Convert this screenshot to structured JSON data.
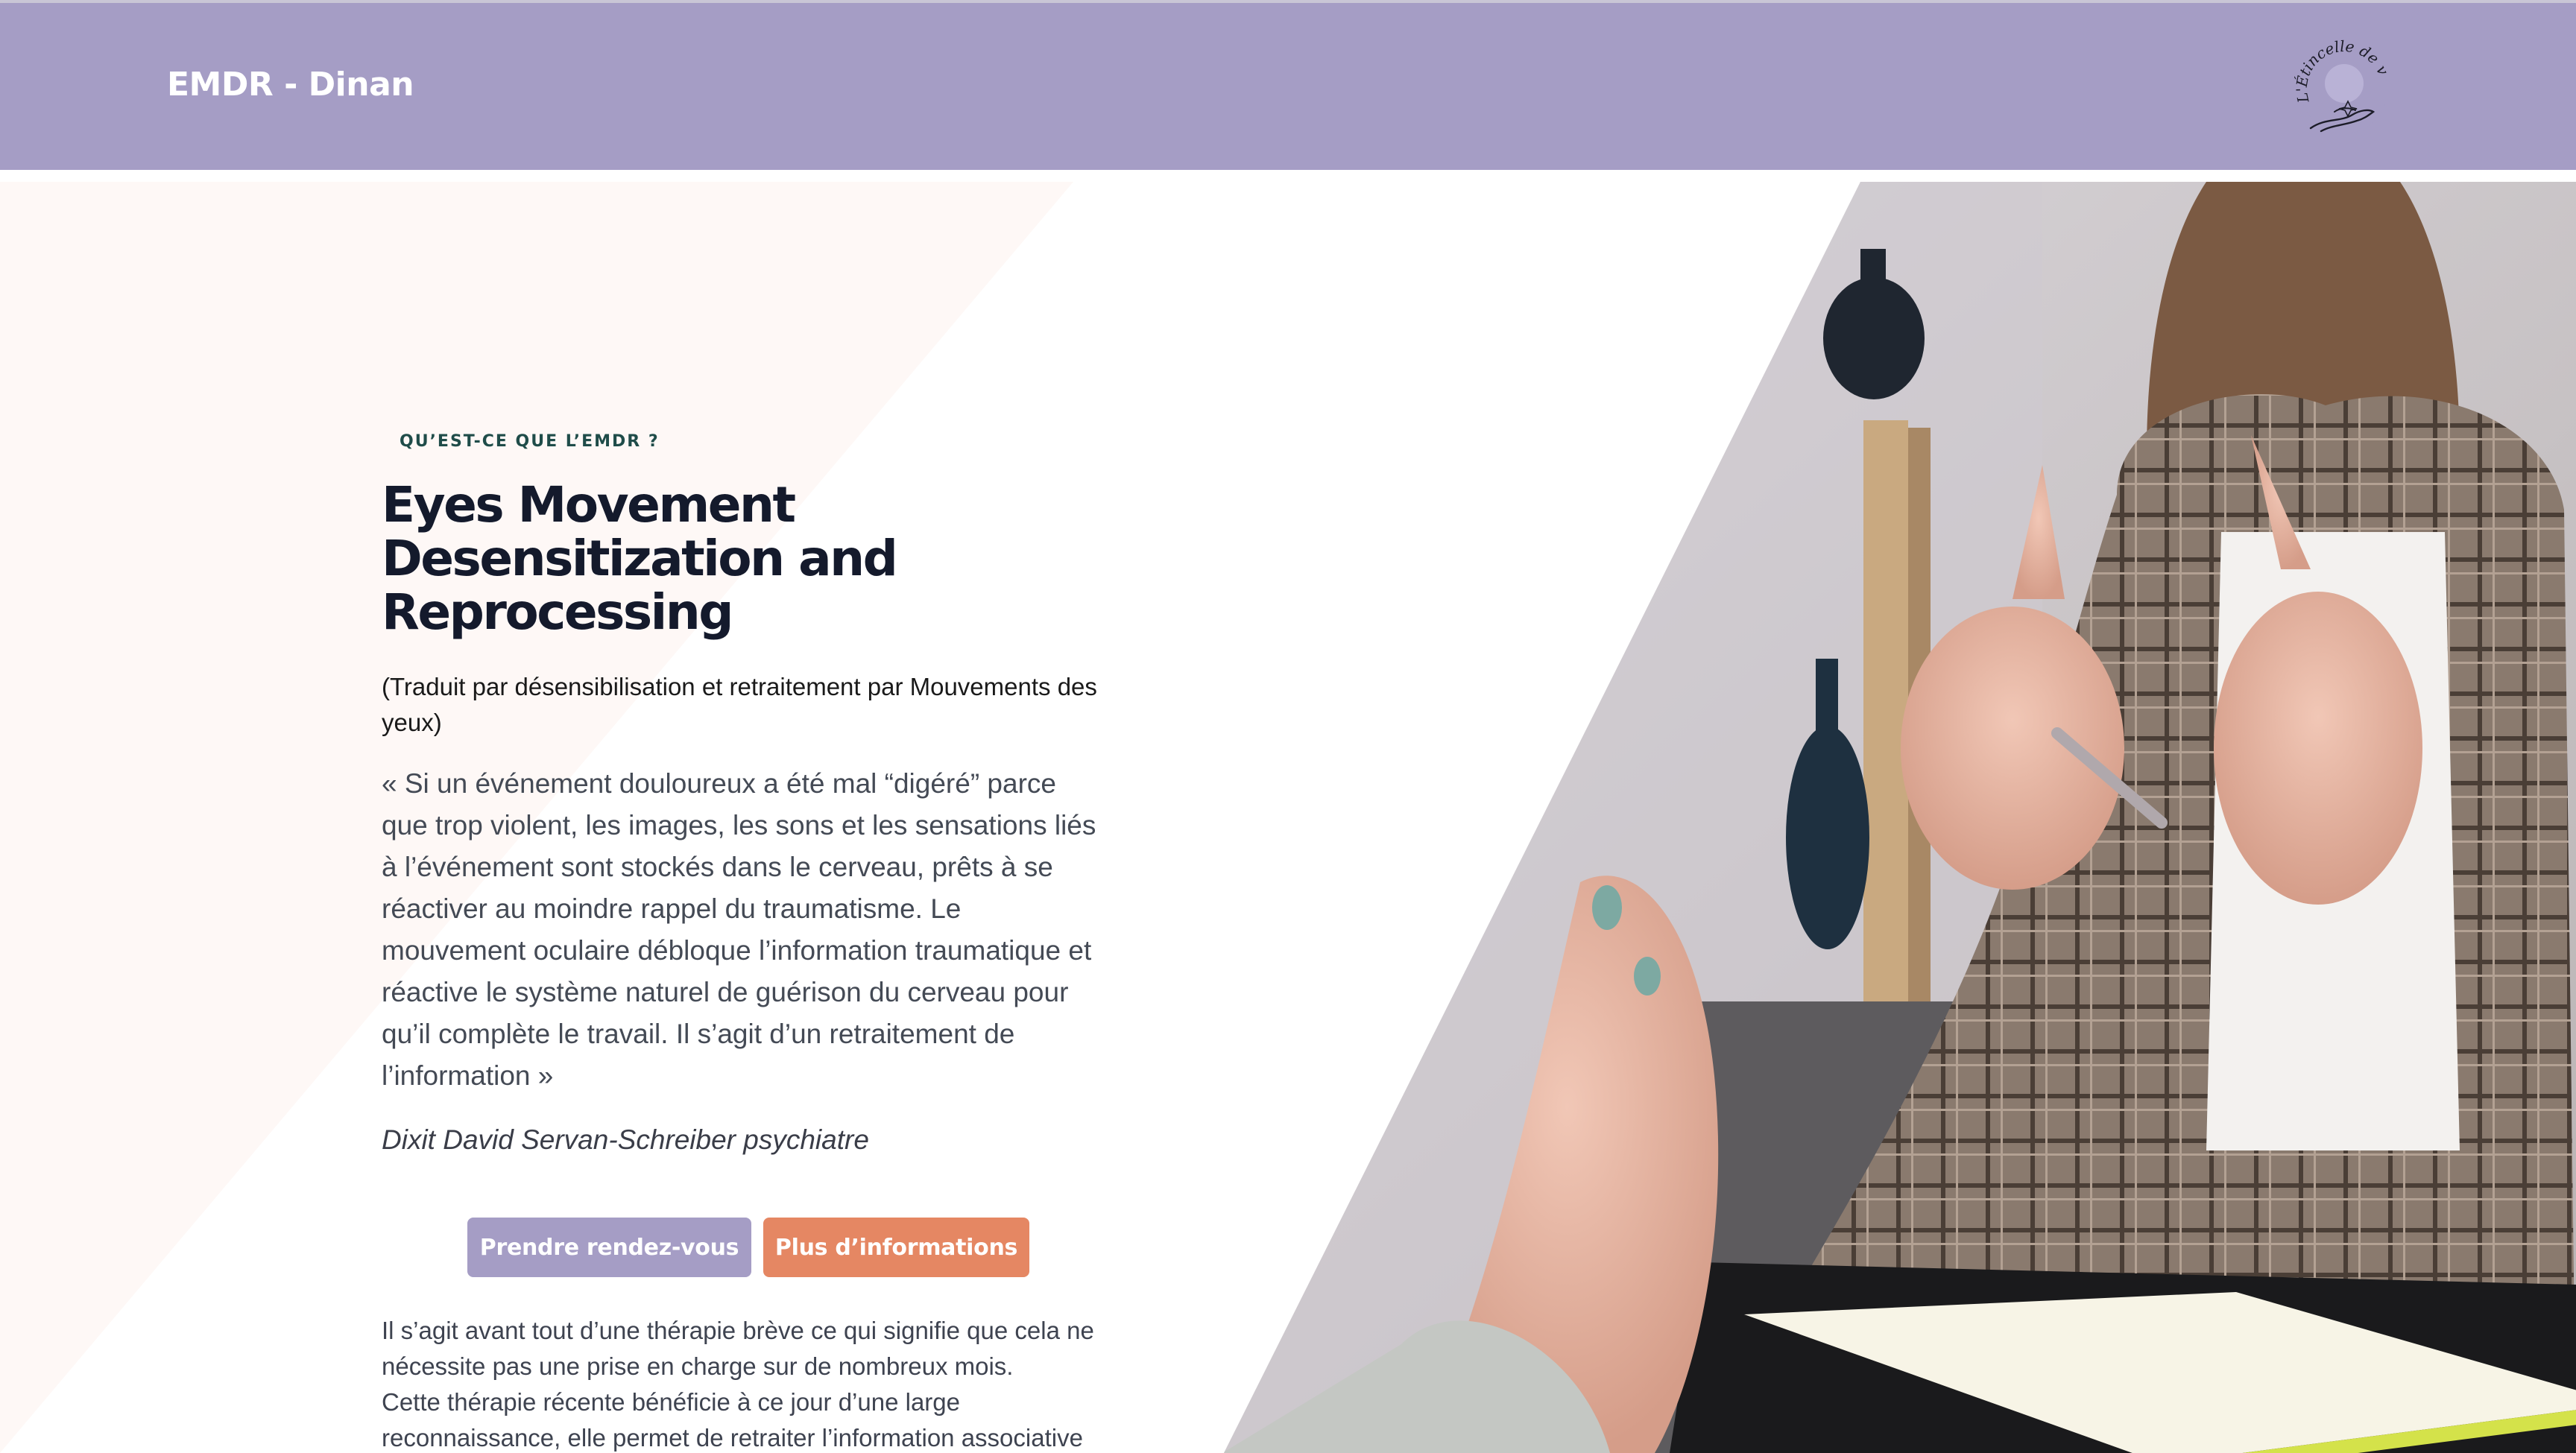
{
  "header": {
    "brand": "EMDR - Dinan",
    "logo_text": "L'Étincelle de vie",
    "background_color": "#a59dc5"
  },
  "hero": {
    "eyebrow": "QU’EST-CE QUE L’EMDR ?",
    "title": "Eyes Movement Desensitization and Reprocessing",
    "subtitle": "(Traduit par désensibilisation et retraitement par Mouvements des yeux)",
    "quote": "« Si un événement douloureux a été mal “digéré” parce que trop violent, les images, les sons et les sensations liés à l’événement sont stockés dans le cerveau, prêts à se réactiver au moindre rappel du traumatisme. Le mouvement oculaire débloque l’information traumatique et réactive le système naturel de guérison du cerveau pour qu’il complète le travail. Il s’agit d’un retraitement de l’information »",
    "author": "Dixit David Servan-Schreiber psychiatre",
    "buttons": {
      "primary_label": "Prendre rendez-vous",
      "secondary_label": "Plus d’informations",
      "primary_color": "#a59dc5",
      "secondary_color": "#e58763"
    },
    "body_line1": "Il s’agit avant tout d’une thérapie brève ce qui signifie que cela ne nécessite pas une prise en charge sur de nombreux mois.",
    "body_line2": "Cette thérapie récente bénéficie à ce jour d’une large reconnaissance, elle permet de retraiter l’information associative à",
    "image": "therapy-session-photo"
  }
}
